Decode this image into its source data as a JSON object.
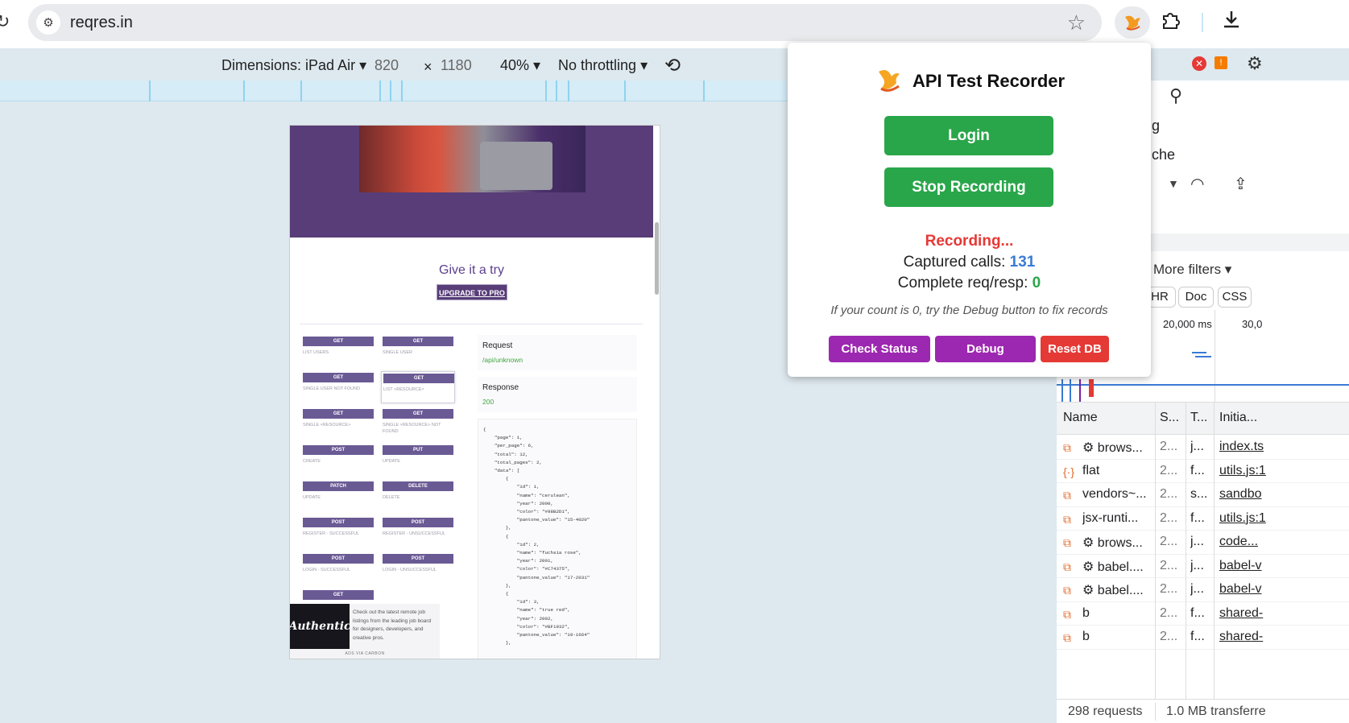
{
  "browser": {
    "url": "reqres.in"
  },
  "device_toolbar": {
    "dimensions_label": "Dimensions: iPad Air",
    "width": "820",
    "times": "×",
    "height": "1180",
    "zoom": "40%",
    "throttling": "No throttling"
  },
  "page": {
    "give_try": "Give it a try",
    "upgrade": "UPGRADE TO PRO",
    "endpoints": [
      {
        "method": "GET",
        "label": "LIST USERS"
      },
      {
        "method": "GET",
        "label": "SINGLE USER"
      },
      {
        "method": "GET",
        "label": "SINGLE USER NOT FOUND"
      },
      {
        "method": "GET",
        "label": "LIST <RESOURCE>"
      },
      {
        "method": "GET",
        "label": "SINGLE <RESOURCE>"
      },
      {
        "method": "GET",
        "label": "SINGLE <RESOURCE> NOT FOUND"
      },
      {
        "method": "POST",
        "label": "CREATE"
      },
      {
        "method": "PUT",
        "label": "UPDATE"
      },
      {
        "method": "PATCH",
        "label": "UPDATE"
      },
      {
        "method": "DELETE",
        "label": "DELETE"
      },
      {
        "method": "POST",
        "label": "REGISTER - SUCCESSFUL"
      },
      {
        "method": "POST",
        "label": "REGISTER - UNSUCCESSFUL"
      },
      {
        "method": "POST",
        "label": "LOGIN - SUCCESSFUL"
      },
      {
        "method": "POST",
        "label": "LOGIN - UNSUCCESSFUL"
      },
      {
        "method": "GET",
        "label": ""
      }
    ],
    "request_title": "Request",
    "request_path": "/api/unknown",
    "response_title": "Response",
    "response_code": "200",
    "json_body": "{\n    \"page\": 1,\n    \"per_page\": 6,\n    \"total\": 12,\n    \"total_pages\": 2,\n    \"data\": [\n        {\n            \"id\": 1,\n            \"name\": \"cerulean\",\n            \"year\": 2000,\n            \"color\": \"#98B2D1\",\n            \"pantone_value\": \"15-4020\"\n        },\n        {\n            \"id\": 2,\n            \"name\": \"fuchsia rose\",\n            \"year\": 2001,\n            \"color\": \"#C74375\",\n            \"pantone_value\": \"17-2031\"\n        },\n        {\n            \"id\": 3,\n            \"name\": \"true red\",\n            \"year\": 2002,\n            \"color\": \"#BF1932\",\n            \"pantone_value\": \"19-1664\"\n        },",
    "ad_image_text": "Authentic",
    "ad_text": "Check out the latest remote job listings from the leading job board for designers, developers, and creative pros.",
    "ad_via": "ADS VIA CARBON"
  },
  "devtools": {
    "partial_g": "g",
    "partial_che": "che",
    "more_filters": "More filters",
    "chips": [
      "HR",
      "Doc",
      "CSS"
    ],
    "time_marks": [
      "20,000 ms",
      "30,0"
    ],
    "columns": [
      "Name",
      "S...",
      "T...",
      "Initia..."
    ],
    "rows": [
      {
        "icon": "doc",
        "name": "⚙ brows...",
        "status": "2...",
        "type": "j...",
        "initiator": "index.ts"
      },
      {
        "icon": "json",
        "name": "flat",
        "status": "2...",
        "type": "f...",
        "initiator": "utils.js:1"
      },
      {
        "icon": "doc",
        "name": "vendors~...",
        "status": "2...",
        "type": "s...",
        "initiator": "sandbo"
      },
      {
        "icon": "doc",
        "name": "jsx-runti...",
        "status": "2...",
        "type": "f...",
        "initiator": "utils.js:1"
      },
      {
        "icon": "doc",
        "name": "⚙ brows...",
        "status": "2...",
        "type": "j...",
        "initiator": "code..."
      },
      {
        "icon": "doc",
        "name": "⚙ babel....",
        "status": "2...",
        "type": "j...",
        "initiator": "babel-v"
      },
      {
        "icon": "doc",
        "name": "⚙ babel....",
        "status": "2...",
        "type": "j...",
        "initiator": "babel-v"
      },
      {
        "icon": "doc",
        "name": "b",
        "status": "2...",
        "type": "f...",
        "initiator": "shared-"
      },
      {
        "icon": "doc",
        "name": "b",
        "status": "2...",
        "type": "f...",
        "initiator": "shared-"
      }
    ],
    "requests": "298 requests",
    "transferred": "1.0 MB transferre"
  },
  "popup": {
    "title": "API Test Recorder",
    "login": "Login",
    "stop": "Stop Recording",
    "status": "Recording...",
    "captured_label": "Captured calls: ",
    "captured_value": "131",
    "complete_label": "Complete req/resp: ",
    "complete_value": "0",
    "hint": "If your count is 0, try the Debug button to fix records",
    "check_status": "Check Status",
    "debug": "Debug",
    "reset_db": "Reset DB"
  },
  "colors": {
    "green": "#2aa64a",
    "purple": "#9c27b0",
    "red": "#e53935",
    "blue": "#3a7bd5",
    "zero_green": "#2aa64a",
    "hero": "#583d78"
  }
}
